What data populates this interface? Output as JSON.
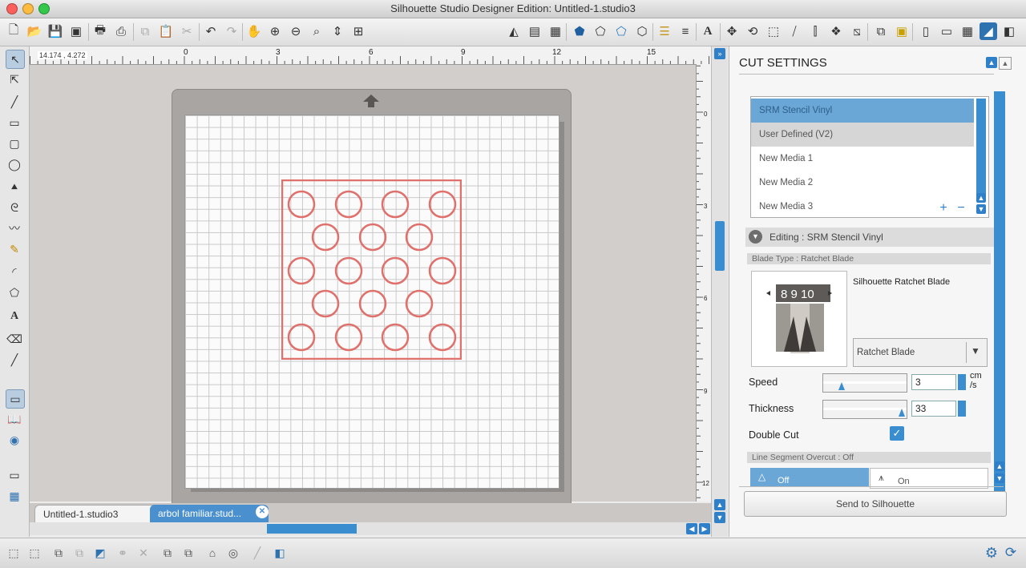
{
  "window": {
    "title": "Silhouette Studio Designer Edition: Untitled-1.studio3"
  },
  "ruler": {
    "coordinates": "14.174 , 4.272",
    "h_ticks": [
      "0",
      "3",
      "6",
      "9",
      "12",
      "15"
    ],
    "v_ticks": [
      "0",
      "3",
      "6",
      "9",
      "12"
    ]
  },
  "tabs": [
    {
      "label": "Untitled-1.studio3",
      "active": true
    },
    {
      "label": "arbol familiar.stud...",
      "active": false
    }
  ],
  "panel": {
    "title": "CUT SETTINGS",
    "media_list": [
      "SRM Stencil Vinyl",
      "User Defined (V2)",
      "New Media 1",
      "New Media 2",
      "New Media 3"
    ],
    "editing_label": "Editing : SRM Stencil Vinyl",
    "blade_type_label": "Blade Type : Ratchet Blade",
    "blade_name": "Silhouette Ratchet Blade",
    "blade_numbers": "8 9 10",
    "blade_select_value": "Ratchet Blade",
    "speed": {
      "label": "Speed",
      "value": "3",
      "unit_line1": "cm",
      "unit_line2": "/s",
      "fraction": 0.2
    },
    "thickness": {
      "label": "Thickness",
      "value": "33",
      "fraction": 0.98
    },
    "double_cut": {
      "label": "Double Cut",
      "checked": true
    },
    "overcut_label": "Line Segment Overcut : Off",
    "overcut_off": "Off",
    "overcut_on": "On",
    "send_button": "Send to Silhouette"
  },
  "colors": {
    "accent": "#3a8ed0",
    "design_stroke": "#e0706b",
    "selected_media": "#6aa6d6"
  }
}
